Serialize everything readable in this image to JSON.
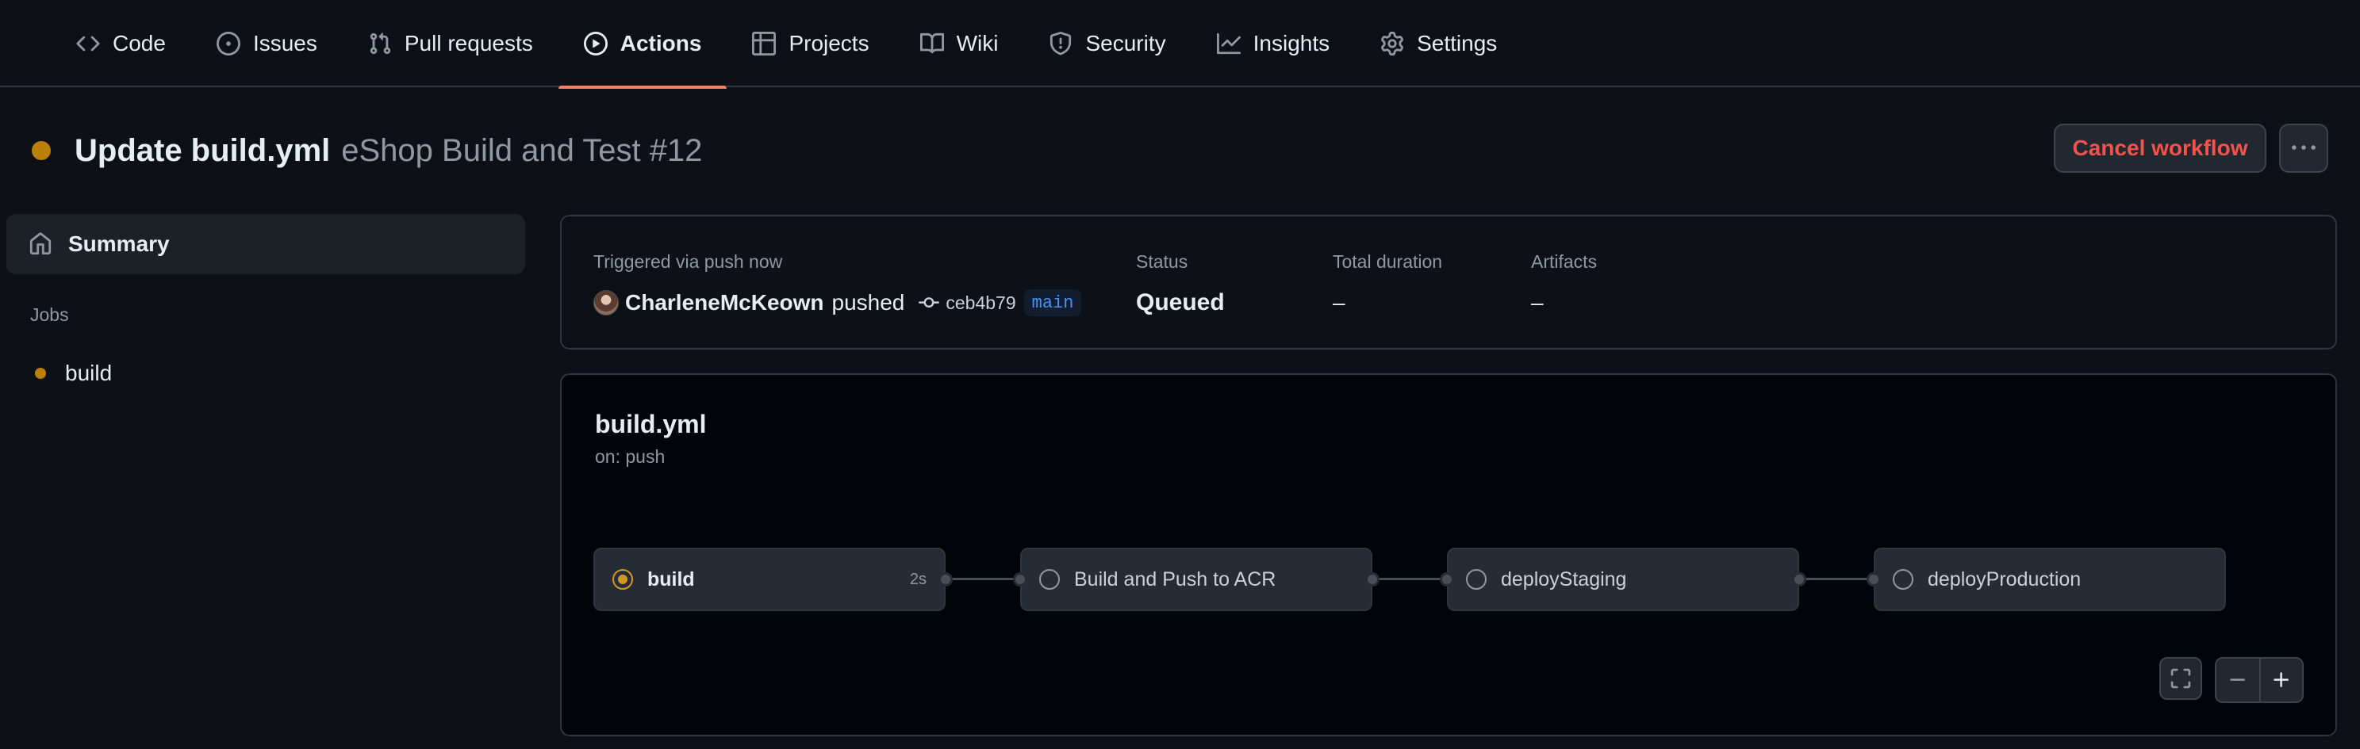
{
  "nav": {
    "tabs": [
      {
        "label": "Code",
        "icon": "code-icon",
        "active": false
      },
      {
        "label": "Issues",
        "icon": "issue-opened-icon",
        "active": false
      },
      {
        "label": "Pull requests",
        "icon": "git-pull-request-icon",
        "active": false
      },
      {
        "label": "Actions",
        "icon": "play-icon",
        "active": true
      },
      {
        "label": "Projects",
        "icon": "table-icon",
        "active": false
      },
      {
        "label": "Wiki",
        "icon": "book-icon",
        "active": false
      },
      {
        "label": "Security",
        "icon": "shield-icon",
        "active": false
      },
      {
        "label": "Insights",
        "icon": "graph-icon",
        "active": false
      },
      {
        "label": "Settings",
        "icon": "gear-icon",
        "active": false
      }
    ],
    "active_underline_color": "#f78166"
  },
  "header": {
    "title": "Update build.yml",
    "subtitle": "eShop Build and Test #12",
    "status_color": "#bb8009",
    "cancel_label": "Cancel workflow",
    "more_icon": "kebab-horizontal-icon"
  },
  "sidebar": {
    "summary_label": "Summary",
    "summary_icon": "home-icon",
    "jobs_heading": "Jobs",
    "jobs": [
      {
        "label": "build",
        "status_color": "#bb8009"
      }
    ]
  },
  "summary": {
    "trigger_label": "Triggered via push now",
    "user": "CharleneMcKeown",
    "action": "pushed",
    "commit_sha": "ceb4b79",
    "branch": "main",
    "status_label": "Status",
    "status_value": "Queued",
    "duration_label": "Total duration",
    "duration_value": "–",
    "artifacts_label": "Artifacts",
    "artifacts_value": "–"
  },
  "workflow": {
    "file": "build.yml",
    "trigger": "on: push",
    "jobs": [
      {
        "name": "build",
        "status": "in_progress",
        "duration": "2s"
      },
      {
        "name": "Build and Push to ACR",
        "status": "queued",
        "duration": ""
      },
      {
        "name": "deployStaging",
        "status": "queued",
        "duration": ""
      },
      {
        "name": "deployProduction",
        "status": "queued",
        "duration": ""
      }
    ]
  },
  "colors": {
    "background": "#0d1117",
    "in_progress": "#d29922",
    "danger": "#f85149",
    "branch_link": "#4493f8"
  }
}
